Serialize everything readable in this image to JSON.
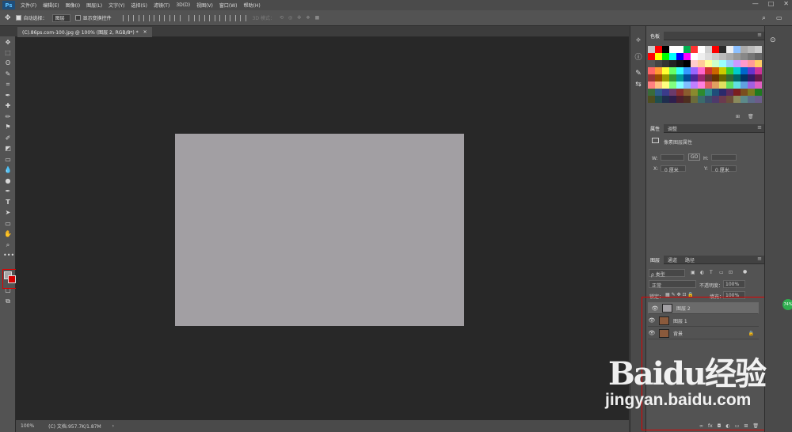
{
  "menubar": {
    "logo": "Ps",
    "items": [
      "文件(F)",
      "编辑(E)",
      "图像(I)",
      "图层(L)",
      "文字(Y)",
      "选择(S)",
      "滤镜(T)",
      "3D(D)",
      "视图(V)",
      "窗口(W)",
      "帮助(H)"
    ],
    "window_controls": [
      "—",
      "□",
      "✕"
    ]
  },
  "options": {
    "auto_select_label": "自动选择：",
    "auto_select_value": "图层",
    "show_transform_label": "显示变换控件",
    "mode_3d": "3D 模式："
  },
  "document": {
    "tab_title": "(C).86ps.com-100.jpg @ 100% (图层 2, RGB/8*) *",
    "tab_close": "×",
    "canvas_color": "#a29fa3"
  },
  "status": {
    "zoom": "100%",
    "doc_info": "(C) 文档:957.7K/1.87M",
    "arrow": "›"
  },
  "colors": {
    "foreground": "#a5a5a5",
    "background": "#d40000"
  },
  "swatches_panel": {
    "tab": "色板"
  },
  "properties_panel": {
    "tabs": [
      "属性",
      "调整"
    ],
    "title": "像素图层属性",
    "w_label": "W:",
    "h_label": "H:",
    "link": "GO",
    "x_label": "X:",
    "x_value": "0 厘米",
    "y_label": "Y:",
    "y_value": "0 厘米"
  },
  "layers_panel": {
    "tabs": [
      "图层",
      "通道",
      "路径"
    ],
    "filter_kind": "ρ 类型",
    "blend_mode": "正常",
    "opacity_label": "不透明度：",
    "opacity_value": "100%",
    "lock_label": "锁定：",
    "fill_label": "填充：",
    "fill_value": "100%",
    "layers": [
      {
        "name": "图层 2",
        "selected": true,
        "thumb": "#a29fa3",
        "locked": false
      },
      {
        "name": "图层 1",
        "selected": false,
        "thumb": "#8a5a3c",
        "locked": false
      },
      {
        "name": "背景",
        "selected": false,
        "thumb": "#8a5a3c",
        "locked": true
      }
    ],
    "bottom_icons": [
      "∞",
      "fx",
      "◘",
      "◐",
      "▭",
      "⊞",
      "🗑"
    ]
  },
  "side_badge": "74%",
  "watermark": {
    "logo": "Baidu经验",
    "url": "jingyan.baidu.com"
  }
}
